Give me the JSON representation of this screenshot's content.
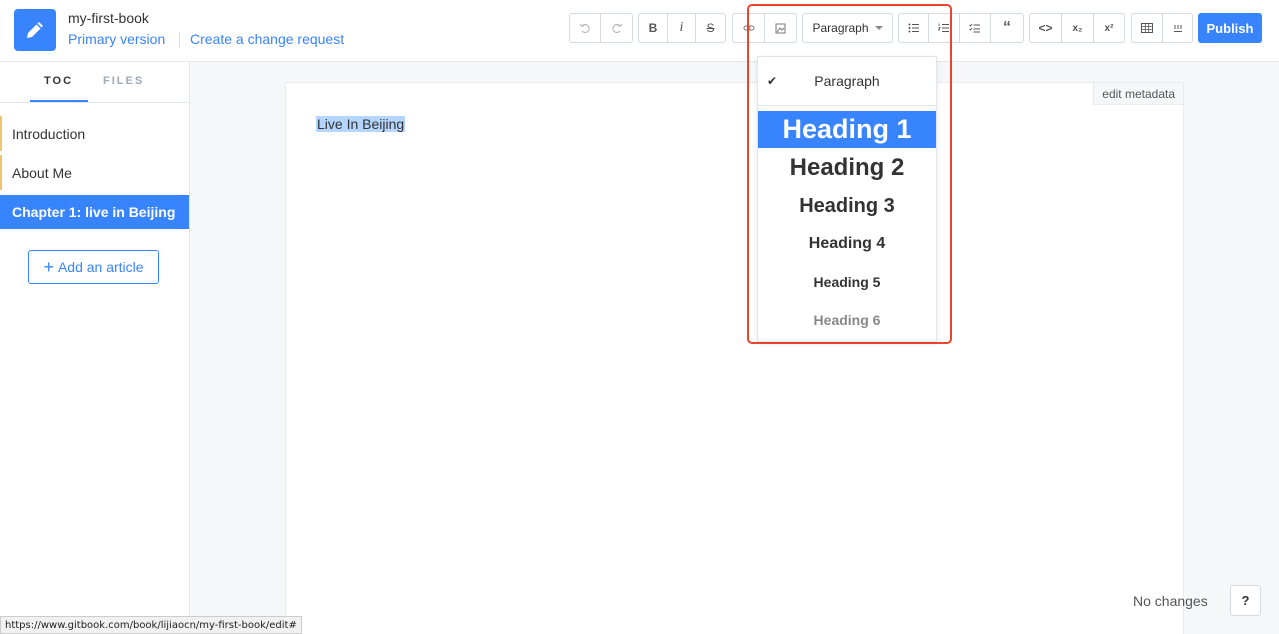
{
  "header": {
    "book_title": "my-first-book",
    "version_link": "Primary version",
    "change_request_link": "Create a change request",
    "publish_label": "Publish"
  },
  "toolbar": {
    "paragraph_label": "Paragraph",
    "bold_label": "B",
    "italic_label": "i",
    "strike_label": "S",
    "subscript_label": "x₂",
    "superscript_label": "x²",
    "quote_label": "“",
    "code_label": "<>",
    "icons": [
      "undo-icon",
      "redo-icon",
      "link-icon",
      "image-icon",
      "bullet-list-icon",
      "numbered-list-icon",
      "task-list-icon",
      "quote-icon",
      "code-icon",
      "table-icon",
      "footnote-icon"
    ]
  },
  "sidebar": {
    "tabs": [
      {
        "label": "TOC",
        "active": true
      },
      {
        "label": "FILES",
        "active": false
      }
    ],
    "items": [
      {
        "label": "Introduction",
        "active": false
      },
      {
        "label": "About Me",
        "active": false
      },
      {
        "label": "Chapter 1: live in Beijing",
        "active": true
      }
    ],
    "add_article_label": "Add an article"
  },
  "editor": {
    "edit_metadata_label": "edit metadata",
    "content_text": "Live In Beijing"
  },
  "dropdown": {
    "items": [
      {
        "label": "Paragraph",
        "checked": true,
        "selected": false
      },
      {
        "label": "Heading 1",
        "checked": false,
        "selected": true
      },
      {
        "label": "Heading 2",
        "checked": false,
        "selected": false
      },
      {
        "label": "Heading 3",
        "checked": false,
        "selected": false
      },
      {
        "label": "Heading 4",
        "checked": false,
        "selected": false
      },
      {
        "label": "Heading 5",
        "checked": false,
        "selected": false
      },
      {
        "label": "Heading 6",
        "checked": false,
        "selected": false
      }
    ]
  },
  "footer": {
    "status_text": "No changes",
    "help_label": "?",
    "status_url": "https://www.gitbook.com/book/lijiaocn/my-first-book/edit#"
  },
  "colors": {
    "accent": "#3884ff",
    "highlight_border": "#e8452c",
    "selection": "#b4d5fe"
  }
}
